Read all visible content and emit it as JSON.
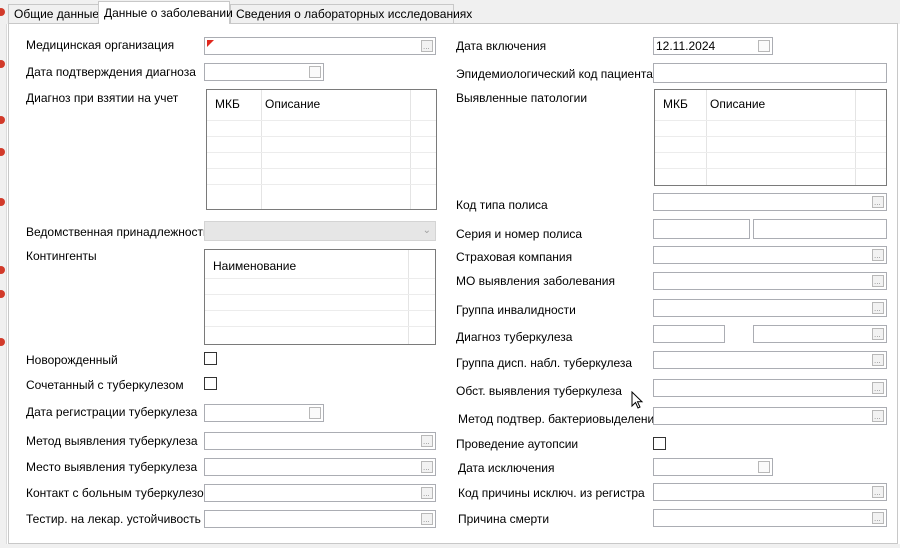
{
  "tabs": [
    {
      "label": "Общие данные",
      "active": false
    },
    {
      "label": "Данные о заболевании",
      "active": true
    },
    {
      "label": "Сведения о лабораторных исследованиях",
      "active": false
    }
  ],
  "left": {
    "med_org": "Медицинская организация",
    "diag_confirm_date": "Дата подтверждения диагноза",
    "diag_on_register": "Диагноз при взятии на учет",
    "diag_grid_headers": [
      "МКБ",
      "Описание"
    ],
    "departmental": "Ведомственная принадлежность",
    "contingents": "Контингенты",
    "contingents_grid_headers": [
      "Наименование"
    ],
    "newborn": "Новорожденный",
    "combined_tb": "Сочетанный с туберкулезом",
    "tb_reg_date": "Дата регистрации туберкулеза",
    "tb_detection_method": "Метод выявления туберкулеза",
    "tb_detection_place": "Место выявления туберкулеза",
    "tb_contact": "Контакт с больным туберкулезом",
    "drug_resistance_test": "Тестир. на лекар. устойчивость"
  },
  "right": {
    "inclusion_date": "Дата включения",
    "inclusion_date_value": "12.11.2024",
    "epid_code": "Эпидемиологический код пациента",
    "detected_pathologies": "Выявленные патологии",
    "path_grid_headers": [
      "МКБ",
      "Описание"
    ],
    "policy_type_code": "Код типа полиса",
    "policy_series_number": "Серия и номер полиса",
    "insurance_company": "Страховая компания",
    "mo_detection": "МО выявления заболевания",
    "disability_group": "Группа инвалидности",
    "tb_diagnosis": "Диагноз туберкулеза",
    "tb_disp_group": "Группа дисп. набл. туберкулеза",
    "tb_detection_circ": "Обст. выявления туберкулеза",
    "bact_confirm_method": "Метод подтвер. бактериовыделения",
    "autopsy": "Проведение аутопсии",
    "exclusion_date": "Дата исключения",
    "exclusion_reason_code": "Код причины исключ. из регистра",
    "death_cause": "Причина смерти"
  },
  "colors": {
    "required_marker": "#e0281e",
    "border": "#abadb3",
    "tab_bg": "#f0f0f0"
  },
  "icons": {
    "picker": "ellipsis-button-icon",
    "calendar": "calendar-icon",
    "dropdown": "chevron-down-icon",
    "required": "required-marker-icon",
    "cursor": "mouse-pointer-icon"
  }
}
